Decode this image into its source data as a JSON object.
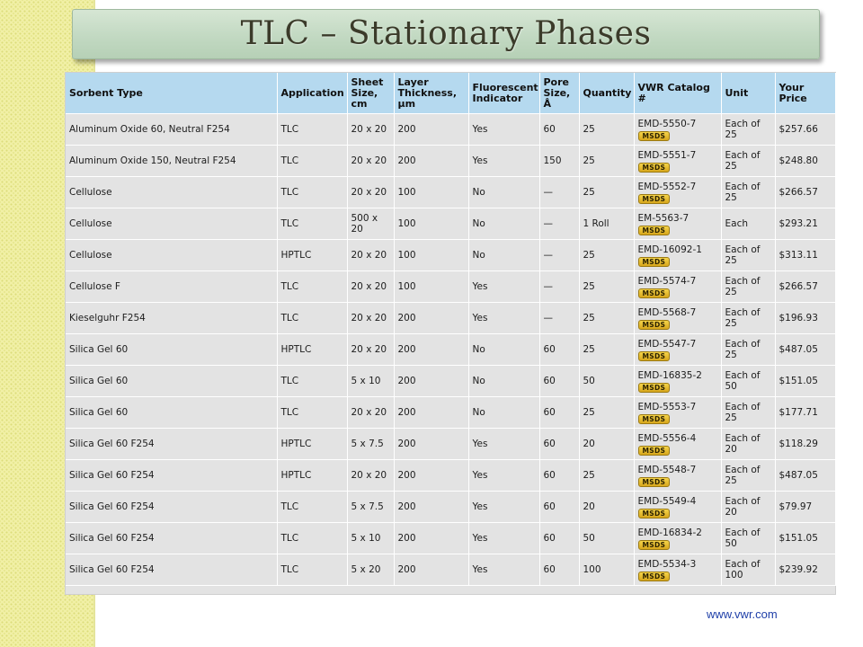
{
  "title": "TLC – Stationary Phases",
  "footer": "www.vwr.com",
  "msds_label": "MSDS",
  "table": {
    "headers": [
      "Sorbent Type",
      "Application",
      "Sheet Size, cm",
      "Layer Thickness, µm",
      "Fluorescent Indicator",
      "Pore Size, Å",
      "Quantity",
      "VWR Catalog #",
      "Unit",
      "Your Price"
    ],
    "rows": [
      [
        "Aluminum Oxide 60, Neutral F254",
        "TLC",
        "20 x 20",
        "200",
        "Yes",
        "60",
        "25",
        "EMD-5550-7",
        "Each of 25",
        "$257.66"
      ],
      [
        "Aluminum Oxide 150, Neutral F254",
        "TLC",
        "20 x 20",
        "200",
        "Yes",
        "150",
        "25",
        "EMD-5551-7",
        "Each of 25",
        "$248.80"
      ],
      [
        "Cellulose",
        "TLC",
        "20 x 20",
        "100",
        "No",
        "—",
        "25",
        "EMD-5552-7",
        "Each of 25",
        "$266.57"
      ],
      [
        "Cellulose",
        "TLC",
        "500 x 20",
        "100",
        "No",
        "—",
        "1 Roll",
        "EM-5563-7",
        "Each",
        "$293.21"
      ],
      [
        "Cellulose",
        "HPTLC",
        "20 x 20",
        "100",
        "No",
        "—",
        "25",
        "EMD-16092-1",
        "Each of 25",
        "$313.11"
      ],
      [
        "Cellulose F",
        "TLC",
        "20 x 20",
        "100",
        "Yes",
        "—",
        "25",
        "EMD-5574-7",
        "Each of 25",
        "$266.57"
      ],
      [
        "Kieselguhr F254",
        "TLC",
        "20 x 20",
        "200",
        "Yes",
        "—",
        "25",
        "EMD-5568-7",
        "Each of 25",
        "$196.93"
      ],
      [
        "Silica Gel 60",
        "HPTLC",
        "20 x 20",
        "200",
        "No",
        "60",
        "25",
        "EMD-5547-7",
        "Each of 25",
        "$487.05"
      ],
      [
        "Silica Gel 60",
        "TLC",
        "5 x 10",
        "200",
        "No",
        "60",
        "50",
        "EMD-16835-2",
        "Each of 50",
        "$151.05"
      ],
      [
        "Silica Gel 60",
        "TLC",
        "20 x 20",
        "200",
        "No",
        "60",
        "25",
        "EMD-5553-7",
        "Each of 25",
        "$177.71"
      ],
      [
        "Silica Gel 60 F254",
        "HPTLC",
        "5 x 7.5",
        "200",
        "Yes",
        "60",
        "20",
        "EMD-5556-4",
        "Each of 20",
        "$118.29"
      ],
      [
        "Silica Gel 60 F254",
        "HPTLC",
        "20 x 20",
        "200",
        "Yes",
        "60",
        "25",
        "EMD-5548-7",
        "Each of 25",
        "$487.05"
      ],
      [
        "Silica Gel 60 F254",
        "TLC",
        "5 x 7.5",
        "200",
        "Yes",
        "60",
        "20",
        "EMD-5549-4",
        "Each of 20",
        "$79.97"
      ],
      [
        "Silica Gel 60 F254",
        "TLC",
        "5 x 10",
        "200",
        "Yes",
        "60",
        "50",
        "EMD-16834-2",
        "Each of 50",
        "$151.05"
      ],
      [
        "Silica Gel 60 F254",
        "TLC",
        "5 x 20",
        "200",
        "Yes",
        "60",
        "100",
        "EMD-5534-3",
        "Each of 100",
        "$239.92"
      ]
    ]
  }
}
